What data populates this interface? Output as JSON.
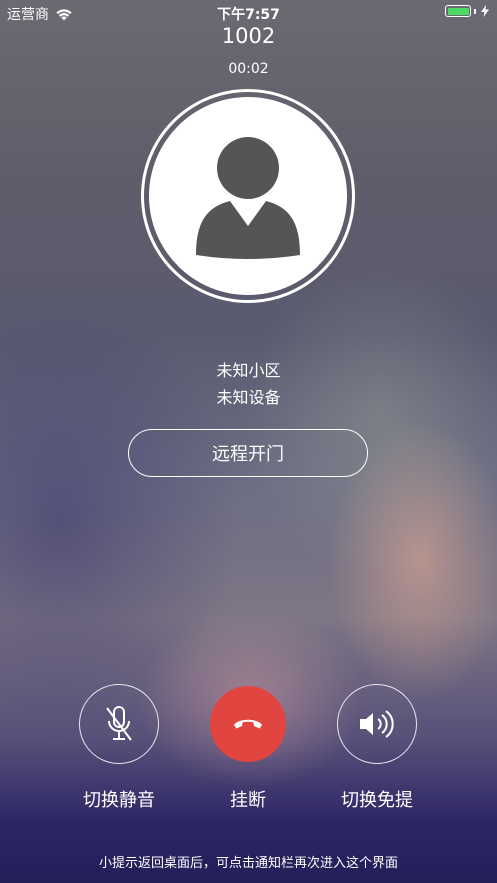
{
  "status_bar": {
    "carrier": "运营商",
    "time": "下午7:57",
    "battery_color": "#4cd964"
  },
  "call": {
    "number": "1002",
    "duration": "00:02",
    "community": "未知小区",
    "device": "未知设备"
  },
  "unlock_button": {
    "label": "远程开门"
  },
  "actions": {
    "mute": {
      "label": "切换静音",
      "icon": "microphone-muted-icon"
    },
    "hangup": {
      "label": "挂断",
      "icon": "phone-hangup-icon",
      "color": "#e0453f"
    },
    "speaker": {
      "label": "切换免提",
      "icon": "speaker-icon"
    }
  },
  "hint": "小提示返回桌面后，可点击通知栏再次进入这个界面"
}
